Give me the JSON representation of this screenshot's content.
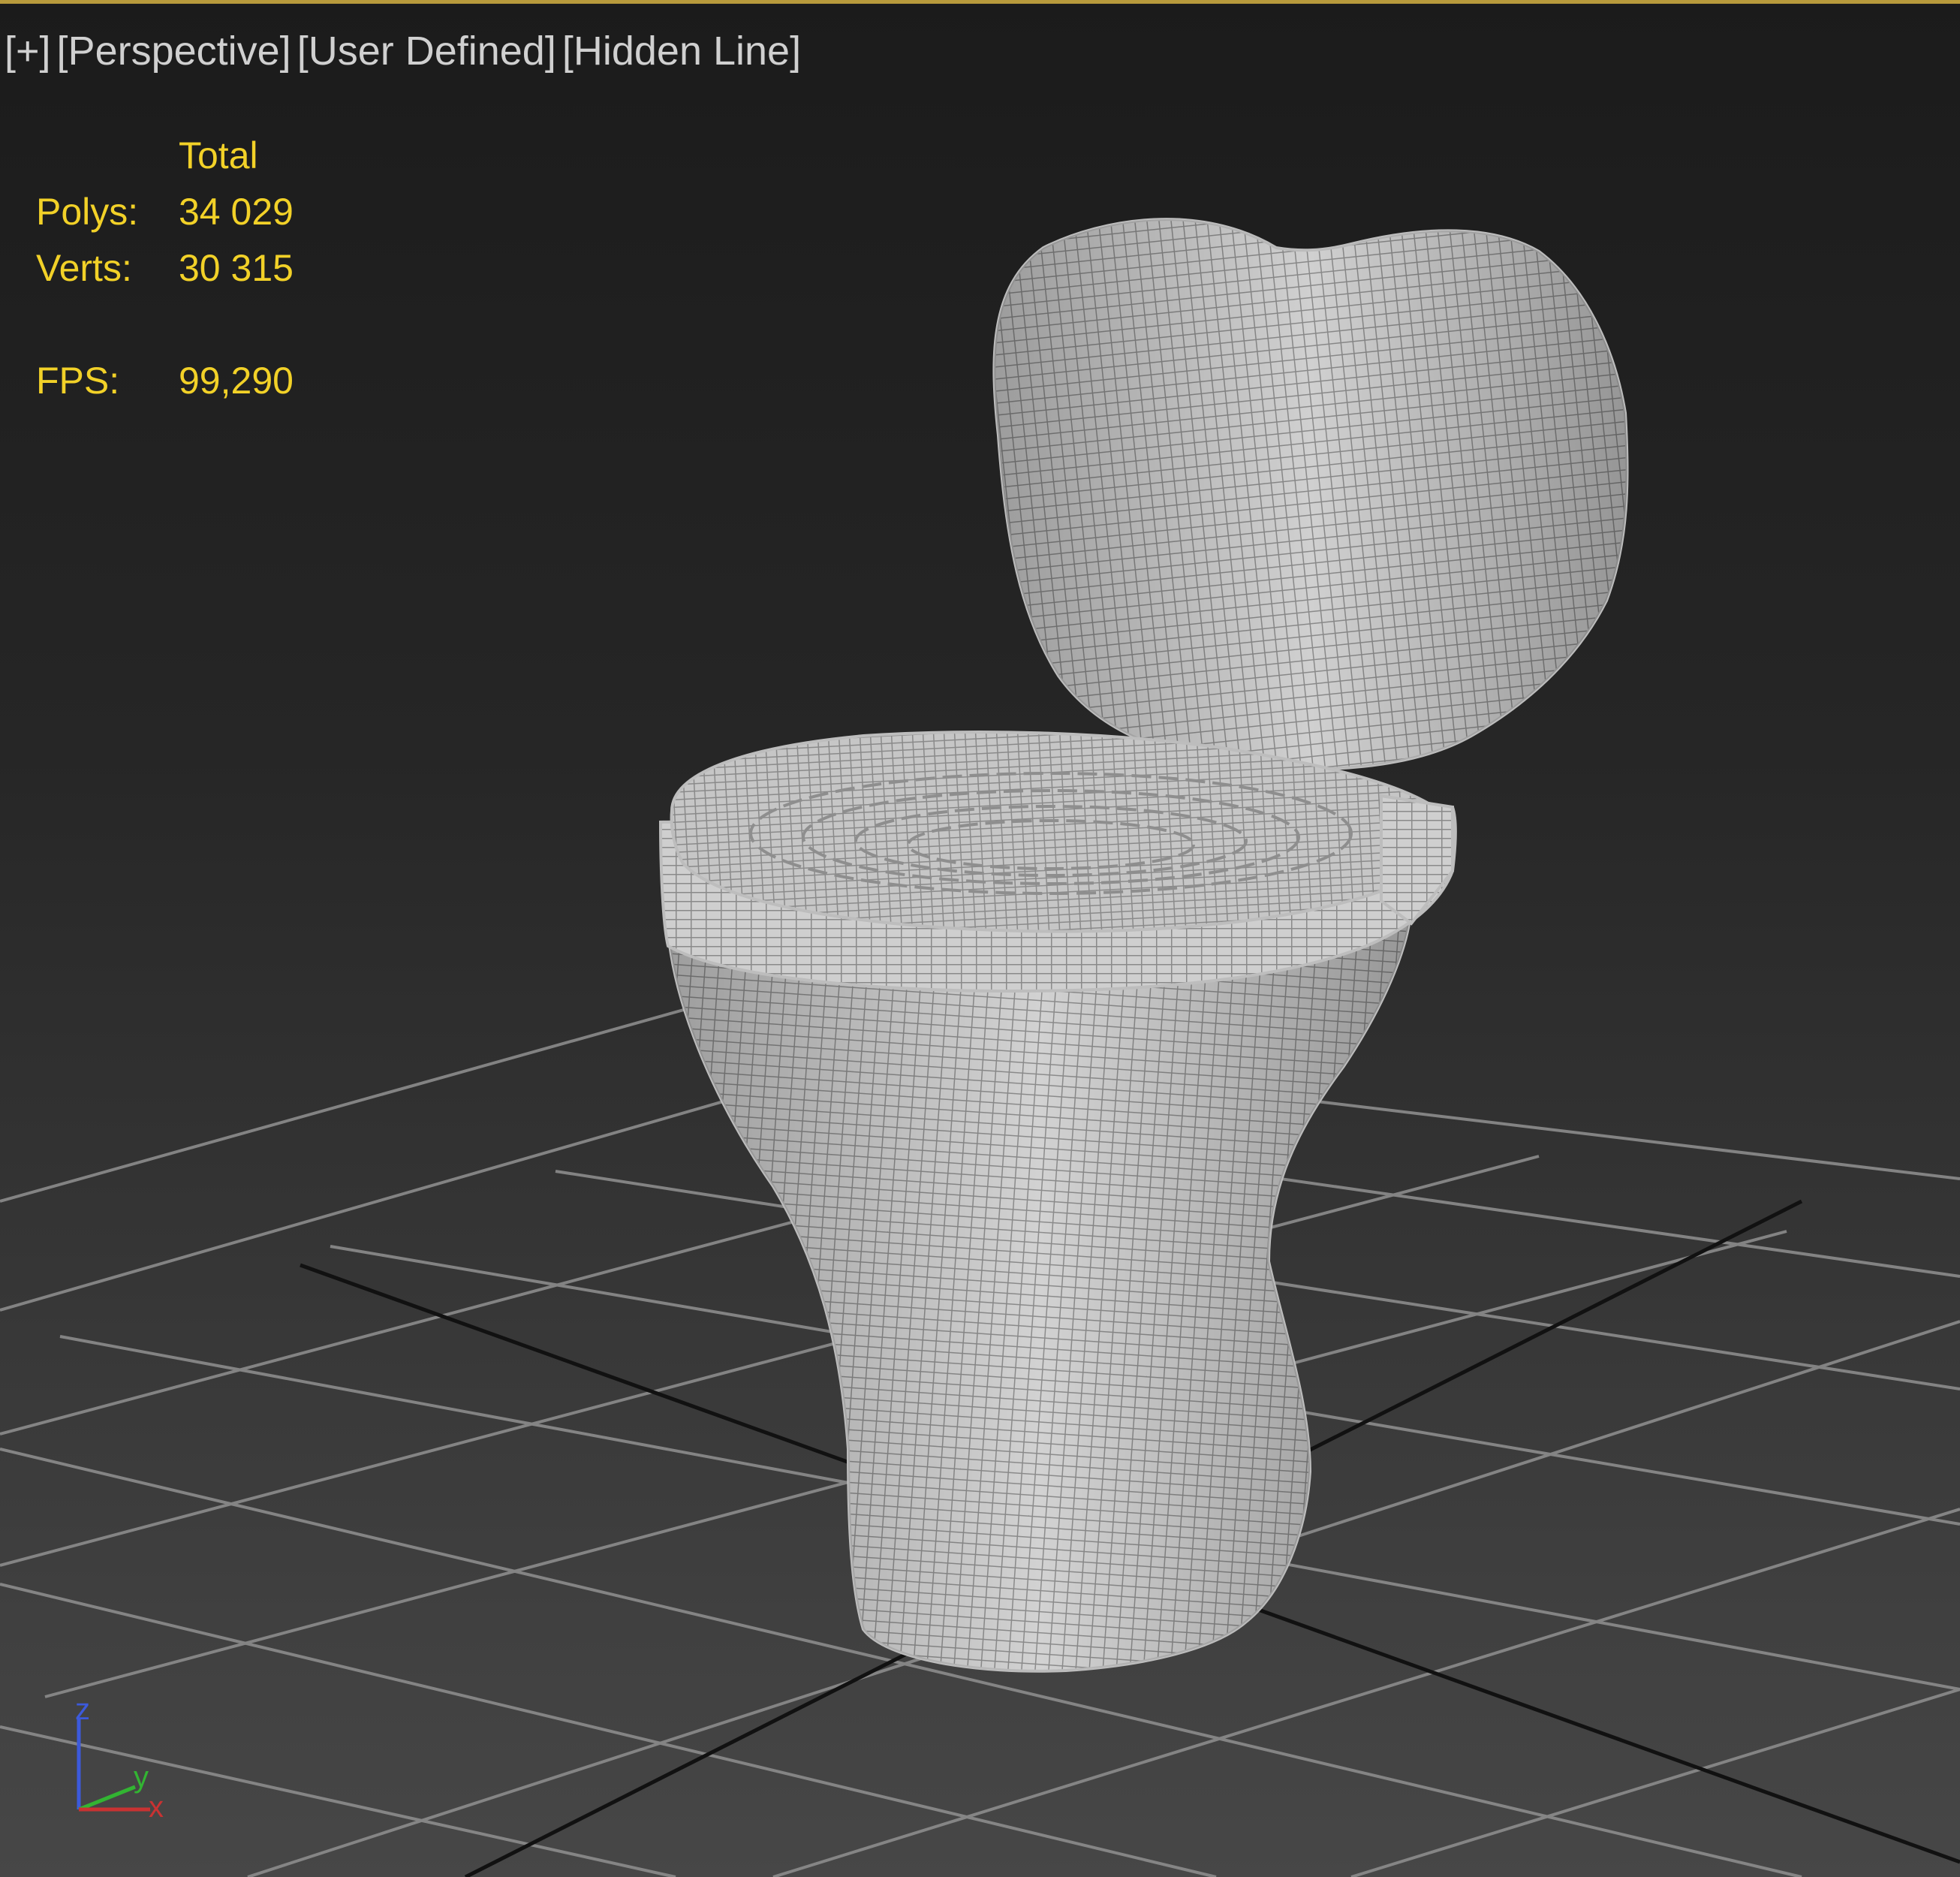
{
  "viewport": {
    "labels": {
      "plus": "[+]",
      "view": "[Perspective]",
      "camera": "[User Defined]",
      "shading": "[Hidden Line]"
    },
    "stats": {
      "header": "Total",
      "polys_label": "Polys:",
      "polys_value": "34 029",
      "verts_label": "Verts:",
      "verts_value": "30 315",
      "fps_label": "FPS:",
      "fps_value": "99,290"
    },
    "axis_gizmo": {
      "z": "z",
      "y": "y",
      "x": "x"
    },
    "colors": {
      "stats_text": "#f2d128",
      "label_text": "#d0d0d0",
      "active_border": "#b89a3c",
      "wire": "#8a8a8a",
      "axis_x": "#c83232",
      "axis_y": "#32b432",
      "axis_z": "#3c5adc"
    },
    "object": "toilet-hidden-line-mesh"
  }
}
